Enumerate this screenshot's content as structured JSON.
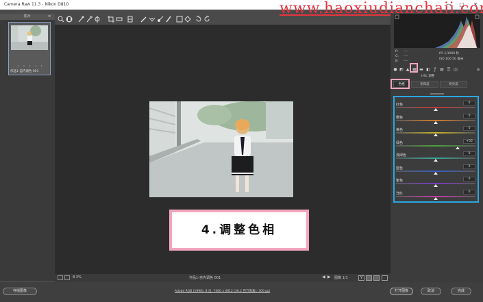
{
  "window": {
    "title": "Camera Raw 11.3  -  Nikon D810",
    "minimize": "—",
    "maximize": "▢",
    "close": "✕"
  },
  "watermark": "www.haoxiudianchaji.com",
  "filmstrip": {
    "header": "影片",
    "menu": "≡",
    "thumb_stars": "• • • • •",
    "thumb_name": "作品1-自内调色 001"
  },
  "canvas": {
    "label": "4.调整色相"
  },
  "status": {
    "zoom": "8.3%",
    "filename": "作品1-自内调色 001",
    "page": "图像 1/1"
  },
  "bottom": {
    "save_image": "存储图像",
    "info_link": "Adobe RGB (1998); 8 位; 7360 x 4912 (36.2 百万像素); 300 ppi",
    "open_image": "打开图像",
    "cancel": "取消",
    "done": "完成"
  },
  "readouts": {
    "r": "R:",
    "g": "G:",
    "b": "B:",
    "dash": "----",
    "exposure": "f/5  1/1000 秒",
    "iso": "ISO 100  50 毫米"
  },
  "panel": {
    "title": "HSL 调整",
    "tabs": [
      "色相",
      "饱和度",
      "明亮度"
    ],
    "sliders": [
      {
        "label": "红色",
        "value": "0",
        "pos": 0.5,
        "color": "#c43a3a"
      },
      {
        "label": "橙色",
        "value": "0",
        "pos": 0.5,
        "color": "#d07a2a"
      },
      {
        "label": "黄色",
        "value": "0",
        "pos": 0.5,
        "color": "#c9b52a"
      },
      {
        "label": "绿色",
        "value": "+56",
        "pos": 0.78,
        "color": "#4aa33a"
      },
      {
        "label": "浅绿色",
        "value": "0",
        "pos": 0.5,
        "color": "#38a89a"
      },
      {
        "label": "蓝色",
        "value": "0",
        "pos": 0.5,
        "color": "#3a5cc4"
      },
      {
        "label": "紫色",
        "value": "0",
        "pos": 0.5,
        "color": "#7a3ac4"
      },
      {
        "label": "洋红",
        "value": "0",
        "pos": 0.5,
        "color": "#c43aa8"
      }
    ]
  },
  "colors": {
    "highlight_pink": "#f2a6bd",
    "highlight_blue": "#2aa7e0"
  }
}
